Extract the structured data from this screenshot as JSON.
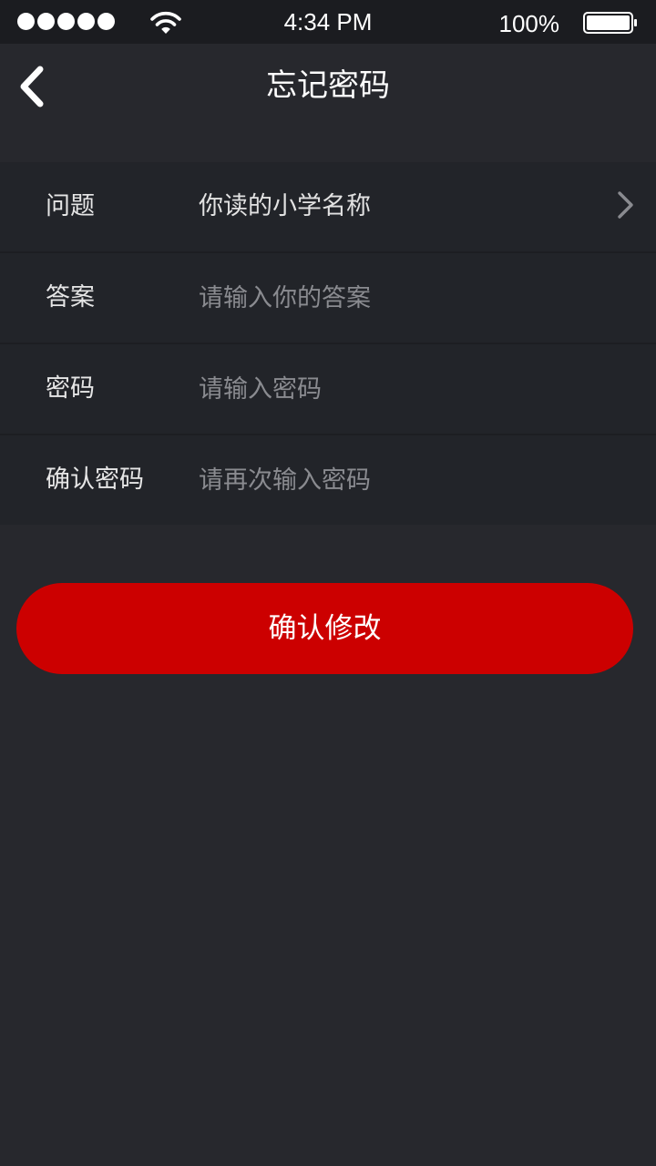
{
  "status_bar": {
    "signal_dots": 5,
    "time": "4:34 PM",
    "battery_percent": "100%",
    "icons": [
      "signal-dots-icon",
      "wifi-icon",
      "battery-icon"
    ]
  },
  "nav": {
    "back_icon": "chevron-left-icon",
    "title": "忘记密码"
  },
  "form": {
    "rows": [
      {
        "label": "问题",
        "value": "你读的小学名称",
        "icon": "chevron-right-icon"
      },
      {
        "label": "答案",
        "value": "",
        "placeholder": "请输入你的答案"
      },
      {
        "label": "密码",
        "value": "",
        "placeholder": "请输入密码"
      },
      {
        "label": "确认密码",
        "value": "",
        "placeholder": "请再次输入密码"
      }
    ]
  },
  "actions": {
    "confirm_label": "确认修改"
  },
  "colors": {
    "background": "#27282d",
    "status_bar": "#1b1c20",
    "form_background": "#222429",
    "accent": "#cc0000",
    "text": "#ffffff",
    "placeholder": "#8a8b90"
  }
}
